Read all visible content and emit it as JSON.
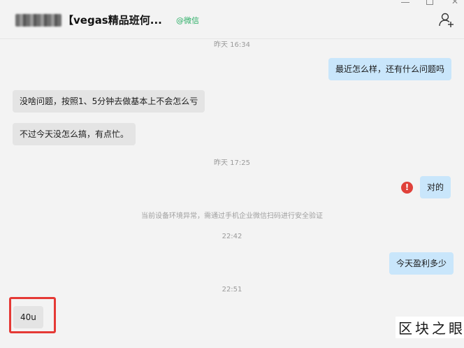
{
  "header": {
    "title": "【vegas精品班何...",
    "source_tag": "@微信",
    "add_member_icon": "add-person-icon"
  },
  "messages": [
    {
      "type": "timestamp",
      "text": "昨天 16:34"
    },
    {
      "type": "out",
      "text": "最近怎么样，还有什么问题吗"
    },
    {
      "type": "in",
      "text": "没啥问题，按照1、5分钟去做基本上不会怎么亏"
    },
    {
      "type": "in",
      "text": "不过今天没怎么搞，有点忙。"
    },
    {
      "type": "timestamp",
      "text": "昨天 17:25"
    },
    {
      "type": "out",
      "text": "对的",
      "status": "failed",
      "status_glyph": "!"
    },
    {
      "type": "notice",
      "text": "当前设备环境异常，需通过手机企业微信扫码进行安全验证"
    },
    {
      "type": "timestamp",
      "text": "22:42"
    },
    {
      "type": "out",
      "text": "今天盈利多少"
    },
    {
      "type": "timestamp",
      "text": "22:51"
    },
    {
      "type": "in",
      "text": "40u",
      "highlighted": true
    }
  ],
  "watermark": "区块之眼",
  "colors": {
    "outgoing_bubble": "#c9e6fb",
    "incoming_bubble": "#e4e4e4",
    "error": "#e0413a",
    "highlight_border": "#e53935",
    "wechat_green": "#2bae66"
  }
}
